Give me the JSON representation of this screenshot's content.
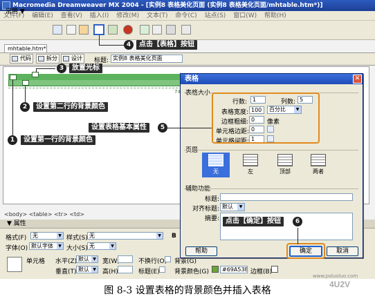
{
  "window": {
    "title": "Macromedia Dreamweaver MX 2004 - [实例8  表格美化页面 (实例8    表格美化页面/mhtable.htm*)]"
  },
  "menubar": [
    "文件(F)",
    "编辑(E)",
    "查看(V)",
    "插入(I)",
    "修改(M)",
    "文本(T)",
    "命令(C)",
    "站点(S)",
    "窗口(W)",
    "帮助(H)"
  ],
  "insert_toolbar": {
    "category": "常用"
  },
  "document": {
    "tab": "mhtable.htm*",
    "buttons": [
      "代码",
      "拆分",
      "设计"
    ],
    "title_label": "标题:",
    "title_value": "实例8  表格美化页面",
    "tag_selector": "<body> <table> <tr> <td>",
    "ruler_number": "74"
  },
  "properties": {
    "header": "▼ 属性",
    "format_label": "格式(F)",
    "format_value": "无",
    "style_label": "样式(S)",
    "style_value": "无",
    "font_label": "字体(O)",
    "font_value": "默认字体",
    "size_label": "大小(S)",
    "size_value": "无",
    "cell_label": "单元格",
    "halign_label": "水平(Z)",
    "halign_value": "默认",
    "valign_label": "垂直(T)",
    "valign_value": "默认",
    "width_label": "宽(W)",
    "height_label": "高(H)",
    "nowrap_label": "不换行(O)",
    "header_label": "标题(E)",
    "bg_label": "背景(G)",
    "bgcolor_label": "背景颜色(G)",
    "bgcolor_value": "#69A538",
    "border_label": "边框(B)",
    "bold_label": "B"
  },
  "dialog": {
    "title": "表格",
    "size_group": "表格大小",
    "rows_label": "行数:",
    "rows_value": "1",
    "cols_label": "列数:",
    "cols_value": "5",
    "width_label": "表格宽度:",
    "width_value": "100",
    "width_unit": "百分比",
    "border_label": "边框粗细:",
    "border_value": "0",
    "border_unit": "像素",
    "padding_label": "单元格边距:",
    "padding_value": "0",
    "spacing_label": "单元格间距:",
    "spacing_value": "1",
    "header_group": "页眉",
    "header_options": [
      "无",
      "左",
      "顶部",
      "两者"
    ],
    "access_group": "辅助功能",
    "caption_label": "标题:",
    "align_label": "对齐标题:",
    "align_value": "默认",
    "summary_label": "摘要:",
    "help_button": "帮助",
    "ok_button": "确定",
    "cancel_button": "取消"
  },
  "annotations": {
    "c1": {
      "num": "1",
      "text": "设置第一行的背景颜色"
    },
    "c2": {
      "num": "2",
      "text": "设置第二行的背景颜色"
    },
    "c3": {
      "num": "3",
      "text": "放置光标"
    },
    "c4": {
      "num": "4",
      "text": "点击【表格】按钮"
    },
    "c5": {
      "num": "5",
      "text": "设置表格基本属性"
    },
    "c6": {
      "num": "6",
      "text": "点击【确定】按钮"
    }
  },
  "caption": "图 8-3    设置表格的背景颜色并插入表格",
  "watermark": "4U2V",
  "watermark_url": "www.psluoluo.com",
  "colors": {
    "table_green": "#69A538",
    "accent_orange": "#E08A1E",
    "titlebar_blue": "#1C3F95"
  }
}
